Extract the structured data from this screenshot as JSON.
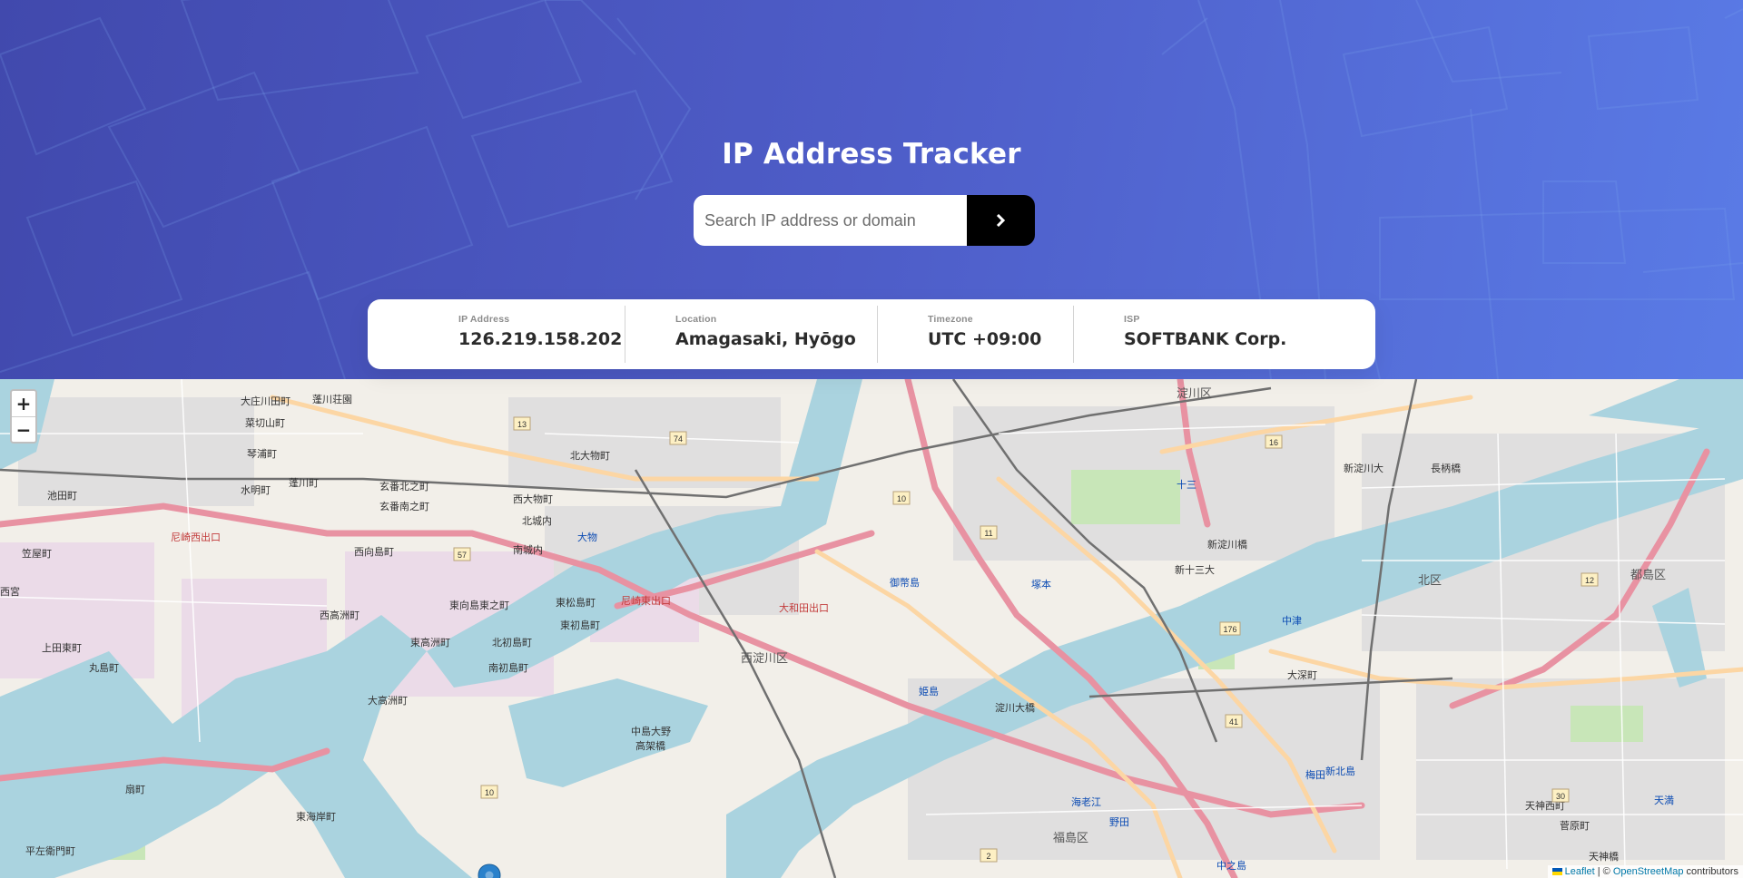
{
  "header": {
    "title": "IP Address Tracker",
    "search_placeholder": "Search IP address or domain",
    "search_icon": "chevron-right-icon"
  },
  "info": [
    {
      "label": "IP Address",
      "value": "126.219.158.202"
    },
    {
      "label": "Location",
      "value": "Amagasaki, Hyōgo"
    },
    {
      "label": "Timezone",
      "value": "UTC +09:00"
    },
    {
      "label": "ISP",
      "value": "SOFTBANK Corp."
    }
  ],
  "map": {
    "zoom_in": "+",
    "zoom_out": "−",
    "marker_icon": "location-pin-icon",
    "attribution": {
      "leaflet": "Leaflet",
      "separator": " | © ",
      "osm": "OpenStreetMap",
      "suffix": " contributors"
    },
    "labels": {
      "l1": "大庄川田町",
      "l2": "菜切山町",
      "l3": "琴浦町",
      "l4": "水明町",
      "l5": "蓬川町",
      "l6": "玄番北之町",
      "l7": "玄番南之町",
      "l8": "西大物町",
      "l9": "北大物町",
      "l10": "北城内",
      "l11": "南城内",
      "l12": "西向島町",
      "l13": "東向島東之町",
      "l14": "東松島町",
      "l15": "東初島町",
      "l16": "西高洲町",
      "l17": "東高洲町",
      "l18": "北初島町",
      "l19": "南初島町",
      "l20": "大高洲町",
      "l21": "東海岸町",
      "l22": "扇町",
      "l23": "平左衛門町",
      "l24": "丸島町",
      "l25": "上田東町",
      "l26": "西淀川区",
      "l27": "中島大野",
      "l28": "高架橋",
      "l29": "淀川区",
      "l30": "新淀川大",
      "l31": "新淀川橋",
      "l32": "長柄橋",
      "l33": "北区",
      "l34": "都島区",
      "l35": "福島区",
      "l36": "淀川大橋",
      "l37": "大深町",
      "l38": "天神橋",
      "l39": "梅田",
      "l40": "中之島",
      "l41": "笠屋町",
      "l42": "池田町",
      "l43": "西宮",
      "l44": "蓬川荘園",
      "l45": "大物",
      "l46": "大和田出口",
      "l47": "尼崎東出口",
      "l48": "尼崎西出口",
      "l49": "塚本",
      "l50": "十三",
      "l51": "新十三大",
      "l52": "中津",
      "l53": "天満",
      "l54": "天神西町",
      "l55": "菅原町",
      "l56": "新北島",
      "l57": "御幣島",
      "l58": "姫島",
      "l59": "野田",
      "l60": "海老江"
    },
    "route_numbers": [
      "13",
      "74",
      "10",
      "11",
      "57",
      "16",
      "176",
      "41",
      "12",
      "30",
      "10",
      "2"
    ]
  }
}
